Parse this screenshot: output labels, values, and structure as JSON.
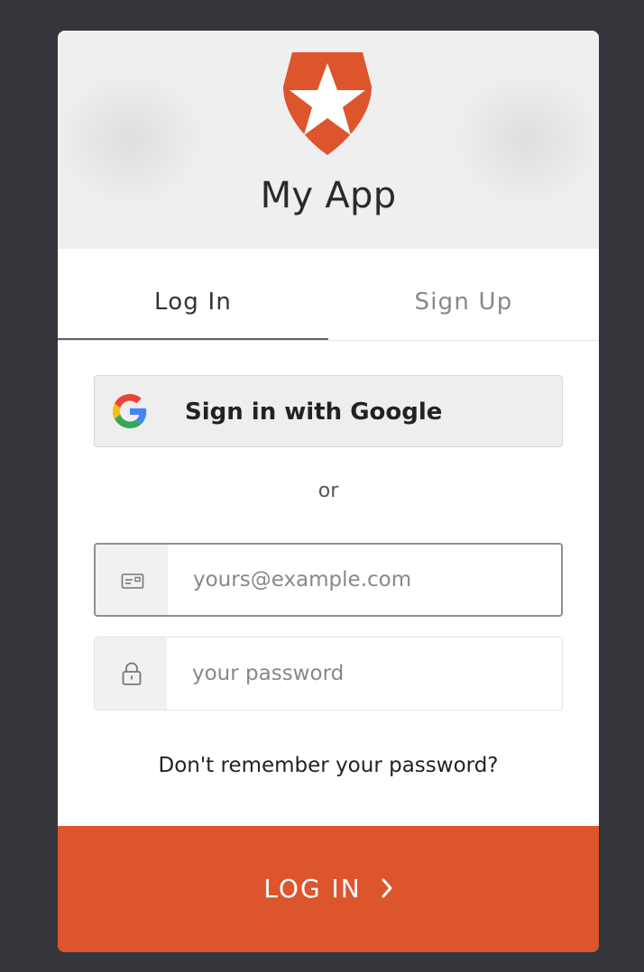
{
  "header": {
    "app_title": "My App",
    "logo_icon": "shield-star-icon",
    "logo_color": "#dd552d"
  },
  "tabs": [
    {
      "label": "Log In",
      "active": true
    },
    {
      "label": "Sign Up",
      "active": false
    }
  ],
  "social": {
    "google_label": "Sign in with Google",
    "google_icon": "google-g-icon"
  },
  "divider_text": "or",
  "form": {
    "email": {
      "placeholder": "yours@example.com",
      "value": "",
      "icon": "envelope-icon"
    },
    "password": {
      "placeholder": "your password",
      "value": "",
      "icon": "lock-icon"
    }
  },
  "forgot_link": "Don't remember your password?",
  "submit": {
    "label": "LOG IN",
    "icon": "chevron-right-icon",
    "color": "#dd552d"
  }
}
